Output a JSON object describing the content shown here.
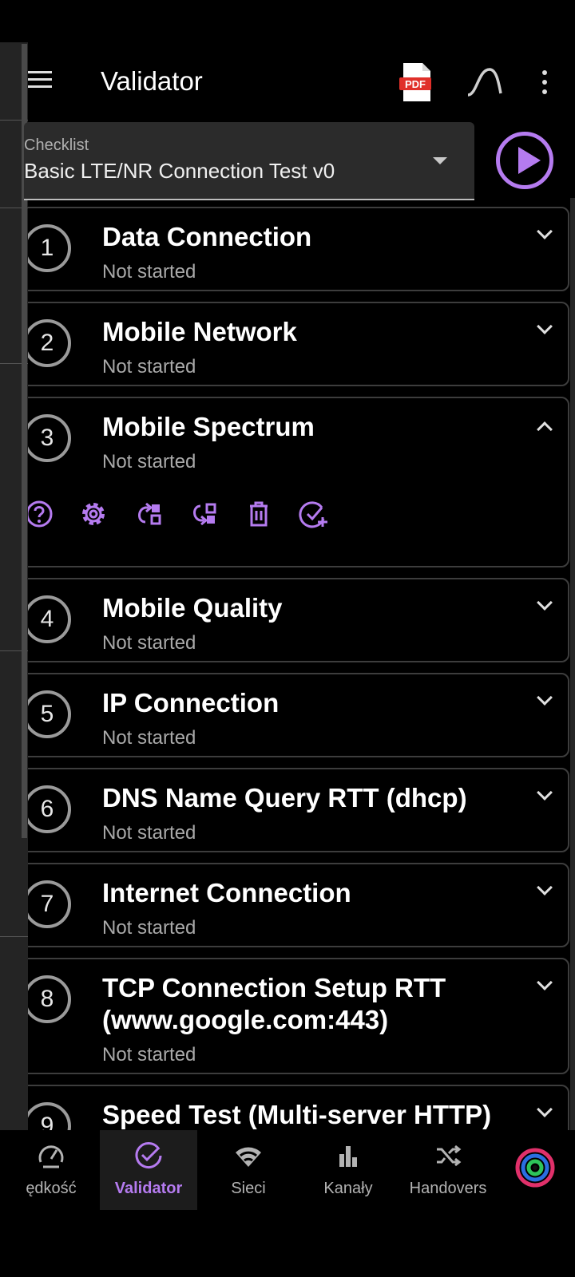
{
  "appbar": {
    "title": "Validator",
    "pdf_label": "PDF",
    "menu_icon": "hamburger-menu-icon",
    "curve_icon": "signal-curve-icon",
    "more_icon": "more-vertical-icon"
  },
  "checklist": {
    "label": "Checklist",
    "value": "Basic LTE/NR Connection Test v0"
  },
  "colors": {
    "accent": "#b57bf0",
    "background": "#000000",
    "card_border": "#3d3d3d",
    "subtext": "#a9a9a9"
  },
  "items": [
    {
      "number": "1",
      "title": "Data Connection",
      "status": "Not started",
      "expanded": false
    },
    {
      "number": "2",
      "title": "Mobile Network",
      "status": "Not started",
      "expanded": false
    },
    {
      "number": "3",
      "title": "Mobile Spectrum",
      "status": "Not started",
      "expanded": true,
      "actions": [
        "help-icon",
        "settings-gear-icon",
        "move-up-icon",
        "move-down-icon",
        "delete-trash-icon",
        "add-check-icon"
      ]
    },
    {
      "number": "4",
      "title": "Mobile Quality",
      "status": "Not started",
      "expanded": false
    },
    {
      "number": "5",
      "title": "IP Connection",
      "status": "Not started",
      "expanded": false
    },
    {
      "number": "6",
      "title": "DNS Name Query RTT (dhcp)",
      "status": "Not started",
      "expanded": false
    },
    {
      "number": "7",
      "title": "Internet Connection",
      "status": "Not started",
      "expanded": false
    },
    {
      "number": "8",
      "title_line1": "TCP Connection Setup RTT",
      "title_line2": "(www.google.com:443)",
      "status": "Not started",
      "expanded": false
    },
    {
      "number": "9",
      "title": "Speed Test (Multi-server HTTP)",
      "expanded": false
    }
  ],
  "bottom_nav": [
    {
      "label": "ędkość",
      "icon": "speedometer-icon",
      "active": false
    },
    {
      "label": "Validator",
      "icon": "check-circle-icon",
      "active": true
    },
    {
      "label": "Sieci",
      "icon": "wifi-icon",
      "active": false
    },
    {
      "label": "Kanały",
      "icon": "bar-chart-icon",
      "active": false
    },
    {
      "label": "Handovers",
      "icon": "shuffle-icon",
      "active": false
    }
  ],
  "app_logo": "app-logo-icon"
}
